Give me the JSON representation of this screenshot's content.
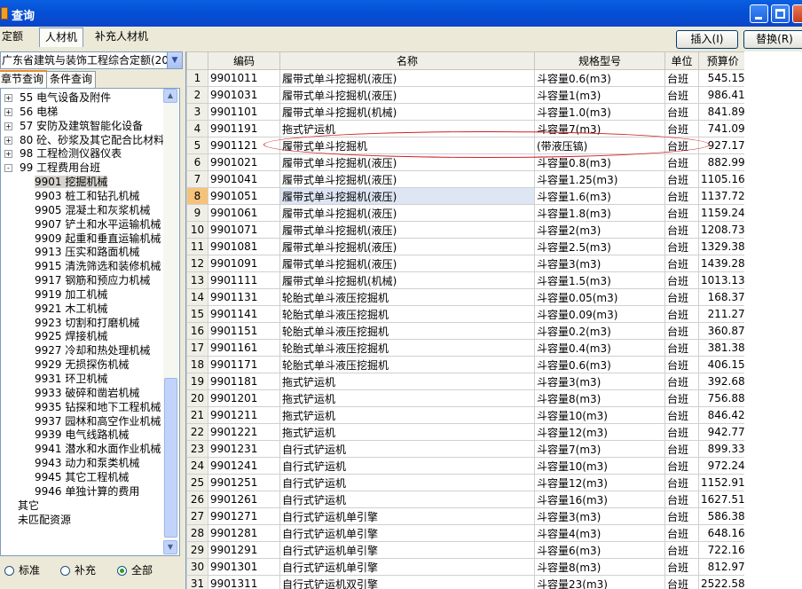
{
  "window": {
    "title": "查询"
  },
  "toolbar": {
    "tabs": [
      {
        "label": "定额"
      },
      {
        "label": "人材机"
      },
      {
        "label": "补充人材机"
      }
    ],
    "insert_label": "插入(I)",
    "replace_label": "替换(R)"
  },
  "left": {
    "combo_value": "广东省建筑与装饰工程综合定额(201",
    "subtabs": [
      {
        "label": "章节查询"
      },
      {
        "label": "条件查询"
      }
    ],
    "tree": [
      {
        "label": "55 电气设备及附件",
        "level": 0,
        "exp": "+"
      },
      {
        "label": "56 电梯",
        "level": 0,
        "exp": "+"
      },
      {
        "label": "57 安防及建筑智能化设备",
        "level": 0,
        "exp": "+"
      },
      {
        "label": "80 砼、砂浆及其它配合比材料",
        "level": 0,
        "exp": "+"
      },
      {
        "label": "98 工程检测仪器仪表",
        "level": 0,
        "exp": "+"
      },
      {
        "label": "99 工程费用台班",
        "level": 0,
        "exp": "-"
      },
      {
        "label": "9901 挖掘机械",
        "level": 1,
        "sel": true
      },
      {
        "label": "9903 桩工和钻孔机械",
        "level": 1
      },
      {
        "label": "9905 混凝土和灰浆机械",
        "level": 1
      },
      {
        "label": "9907 铲土和水平运输机械",
        "level": 1
      },
      {
        "label": "9909 起重和垂直运输机械",
        "level": 1
      },
      {
        "label": "9913 压实和路面机械",
        "level": 1
      },
      {
        "label": "9915 清洗筛选和装修机械",
        "level": 1
      },
      {
        "label": "9917 钢筋和预应力机械",
        "level": 1
      },
      {
        "label": "9919 加工机械",
        "level": 1
      },
      {
        "label": "9921 木工机械",
        "level": 1
      },
      {
        "label": "9923 切割和打磨机械",
        "level": 1
      },
      {
        "label": "9925 焊接机械",
        "level": 1
      },
      {
        "label": "9927 冷却和热处理机械",
        "level": 1
      },
      {
        "label": "9929 无损探伤机械",
        "level": 1
      },
      {
        "label": "9931 环卫机械",
        "level": 1
      },
      {
        "label": "9933 破碎和凿岩机械",
        "level": 1
      },
      {
        "label": "9935 钻探和地下工程机械",
        "level": 1
      },
      {
        "label": "9937 园林和高空作业机械",
        "level": 1
      },
      {
        "label": "9939 电气线路机械",
        "level": 1
      },
      {
        "label": "9941 潜水和水面作业机械",
        "level": 1
      },
      {
        "label": "9943 动力和泵类机械",
        "level": 1
      },
      {
        "label": "9945 其它工程机械",
        "level": 1
      },
      {
        "label": "9946 单独计算的费用",
        "level": 1
      },
      {
        "label": "其它",
        "level": -1
      },
      {
        "label": "未匹配资源",
        "level": -1
      }
    ],
    "radios": [
      {
        "label": "标准",
        "checked": false
      },
      {
        "label": "补充",
        "checked": false
      },
      {
        "label": "全部",
        "checked": true
      }
    ]
  },
  "grid": {
    "headers": [
      "",
      "编码",
      "名称",
      "规格型号",
      "单位",
      "预算价"
    ],
    "current_row": 8,
    "rows": [
      [
        "1",
        "9901011",
        "履带式单斗挖掘机(液压)",
        "斗容量0.6(m3)",
        "台班",
        "545.15"
      ],
      [
        "2",
        "9901031",
        "履带式单斗挖掘机(液压)",
        "斗容量1(m3)",
        "台班",
        "986.41"
      ],
      [
        "3",
        "9901101",
        "履带式单斗挖掘机(机械)",
        "斗容量1.0(m3)",
        "台班",
        "841.89"
      ],
      [
        "4",
        "9901191",
        "拖式铲运机",
        "斗容量7(m3)",
        "台班",
        "741.09"
      ],
      [
        "5",
        "9901121",
        "履带式单斗挖掘机",
        "(带液压镐)",
        "台班",
        "927.17"
      ],
      [
        "6",
        "9901021",
        "履带式单斗挖掘机(液压)",
        "斗容量0.8(m3)",
        "台班",
        "882.99"
      ],
      [
        "7",
        "9901041",
        "履带式单斗挖掘机(液压)",
        "斗容量1.25(m3)",
        "台班",
        "1105.16"
      ],
      [
        "8",
        "9901051",
        "履带式单斗挖掘机(液压)",
        "斗容量1.6(m3)",
        "台班",
        "1137.72"
      ],
      [
        "9",
        "9901061",
        "履带式单斗挖掘机(液压)",
        "斗容量1.8(m3)",
        "台班",
        "1159.24"
      ],
      [
        "10",
        "9901071",
        "履带式单斗挖掘机(液压)",
        "斗容量2(m3)",
        "台班",
        "1208.73"
      ],
      [
        "11",
        "9901081",
        "履带式单斗挖掘机(液压)",
        "斗容量2.5(m3)",
        "台班",
        "1329.38"
      ],
      [
        "12",
        "9901091",
        "履带式单斗挖掘机(液压)",
        "斗容量3(m3)",
        "台班",
        "1439.28"
      ],
      [
        "13",
        "9901111",
        "履带式单斗挖掘机(机械)",
        "斗容量1.5(m3)",
        "台班",
        "1013.13"
      ],
      [
        "14",
        "9901131",
        "轮胎式单斗液压挖掘机",
        "斗容量0.05(m3)",
        "台班",
        "168.37"
      ],
      [
        "15",
        "9901141",
        "轮胎式单斗液压挖掘机",
        "斗容量0.09(m3)",
        "台班",
        "211.27"
      ],
      [
        "16",
        "9901151",
        "轮胎式单斗液压挖掘机",
        "斗容量0.2(m3)",
        "台班",
        "360.87"
      ],
      [
        "17",
        "9901161",
        "轮胎式单斗液压挖掘机",
        "斗容量0.4(m3)",
        "台班",
        "381.38"
      ],
      [
        "18",
        "9901171",
        "轮胎式单斗液压挖掘机",
        "斗容量0.6(m3)",
        "台班",
        "406.15"
      ],
      [
        "19",
        "9901181",
        "拖式铲运机",
        "斗容量3(m3)",
        "台班",
        "392.68"
      ],
      [
        "20",
        "9901201",
        "拖式铲运机",
        "斗容量8(m3)",
        "台班",
        "756.88"
      ],
      [
        "21",
        "9901211",
        "拖式铲运机",
        "斗容量10(m3)",
        "台班",
        "846.42"
      ],
      [
        "22",
        "9901221",
        "拖式铲运机",
        "斗容量12(m3)",
        "台班",
        "942.77"
      ],
      [
        "23",
        "9901231",
        "自行式铲运机",
        "斗容量7(m3)",
        "台班",
        "899.33"
      ],
      [
        "24",
        "9901241",
        "自行式铲运机",
        "斗容量10(m3)",
        "台班",
        "972.24"
      ],
      [
        "25",
        "9901251",
        "自行式铲运机",
        "斗容量12(m3)",
        "台班",
        "1152.91"
      ],
      [
        "26",
        "9901261",
        "自行式铲运机",
        "斗容量16(m3)",
        "台班",
        "1627.51"
      ],
      [
        "27",
        "9901271",
        "自行式铲运机单引擎",
        "斗容量3(m3)",
        "台班",
        "586.38"
      ],
      [
        "28",
        "9901281",
        "自行式铲运机单引擎",
        "斗容量4(m3)",
        "台班",
        "648.16"
      ],
      [
        "29",
        "9901291",
        "自行式铲运机单引擎",
        "斗容量6(m3)",
        "台班",
        "722.16"
      ],
      [
        "30",
        "9901301",
        "自行式铲运机单引擎",
        "斗容量8(m3)",
        "台班",
        "812.97"
      ],
      [
        "31",
        "9901311",
        "自行式铲运机双引擎",
        "斗容量23(m3)",
        "台班",
        "2522.58"
      ]
    ]
  }
}
